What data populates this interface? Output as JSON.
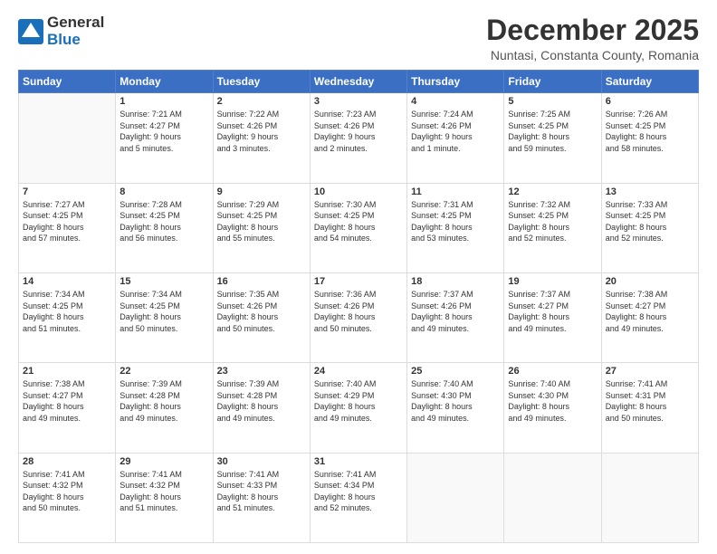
{
  "header": {
    "logo_general": "General",
    "logo_blue": "Blue",
    "month_title": "December 2025",
    "subtitle": "Nuntasi, Constanta County, Romania"
  },
  "weekdays": [
    "Sunday",
    "Monday",
    "Tuesday",
    "Wednesday",
    "Thursday",
    "Friday",
    "Saturday"
  ],
  "weeks": [
    [
      {
        "day": "",
        "info": ""
      },
      {
        "day": "1",
        "info": "Sunrise: 7:21 AM\nSunset: 4:27 PM\nDaylight: 9 hours\nand 5 minutes."
      },
      {
        "day": "2",
        "info": "Sunrise: 7:22 AM\nSunset: 4:26 PM\nDaylight: 9 hours\nand 3 minutes."
      },
      {
        "day": "3",
        "info": "Sunrise: 7:23 AM\nSunset: 4:26 PM\nDaylight: 9 hours\nand 2 minutes."
      },
      {
        "day": "4",
        "info": "Sunrise: 7:24 AM\nSunset: 4:26 PM\nDaylight: 9 hours\nand 1 minute."
      },
      {
        "day": "5",
        "info": "Sunrise: 7:25 AM\nSunset: 4:25 PM\nDaylight: 8 hours\nand 59 minutes."
      },
      {
        "day": "6",
        "info": "Sunrise: 7:26 AM\nSunset: 4:25 PM\nDaylight: 8 hours\nand 58 minutes."
      }
    ],
    [
      {
        "day": "7",
        "info": "Sunrise: 7:27 AM\nSunset: 4:25 PM\nDaylight: 8 hours\nand 57 minutes."
      },
      {
        "day": "8",
        "info": "Sunrise: 7:28 AM\nSunset: 4:25 PM\nDaylight: 8 hours\nand 56 minutes."
      },
      {
        "day": "9",
        "info": "Sunrise: 7:29 AM\nSunset: 4:25 PM\nDaylight: 8 hours\nand 55 minutes."
      },
      {
        "day": "10",
        "info": "Sunrise: 7:30 AM\nSunset: 4:25 PM\nDaylight: 8 hours\nand 54 minutes."
      },
      {
        "day": "11",
        "info": "Sunrise: 7:31 AM\nSunset: 4:25 PM\nDaylight: 8 hours\nand 53 minutes."
      },
      {
        "day": "12",
        "info": "Sunrise: 7:32 AM\nSunset: 4:25 PM\nDaylight: 8 hours\nand 52 minutes."
      },
      {
        "day": "13",
        "info": "Sunrise: 7:33 AM\nSunset: 4:25 PM\nDaylight: 8 hours\nand 52 minutes."
      }
    ],
    [
      {
        "day": "14",
        "info": "Sunrise: 7:34 AM\nSunset: 4:25 PM\nDaylight: 8 hours\nand 51 minutes."
      },
      {
        "day": "15",
        "info": "Sunrise: 7:34 AM\nSunset: 4:25 PM\nDaylight: 8 hours\nand 50 minutes."
      },
      {
        "day": "16",
        "info": "Sunrise: 7:35 AM\nSunset: 4:26 PM\nDaylight: 8 hours\nand 50 minutes."
      },
      {
        "day": "17",
        "info": "Sunrise: 7:36 AM\nSunset: 4:26 PM\nDaylight: 8 hours\nand 50 minutes."
      },
      {
        "day": "18",
        "info": "Sunrise: 7:37 AM\nSunset: 4:26 PM\nDaylight: 8 hours\nand 49 minutes."
      },
      {
        "day": "19",
        "info": "Sunrise: 7:37 AM\nSunset: 4:27 PM\nDaylight: 8 hours\nand 49 minutes."
      },
      {
        "day": "20",
        "info": "Sunrise: 7:38 AM\nSunset: 4:27 PM\nDaylight: 8 hours\nand 49 minutes."
      }
    ],
    [
      {
        "day": "21",
        "info": "Sunrise: 7:38 AM\nSunset: 4:27 PM\nDaylight: 8 hours\nand 49 minutes."
      },
      {
        "day": "22",
        "info": "Sunrise: 7:39 AM\nSunset: 4:28 PM\nDaylight: 8 hours\nand 49 minutes."
      },
      {
        "day": "23",
        "info": "Sunrise: 7:39 AM\nSunset: 4:28 PM\nDaylight: 8 hours\nand 49 minutes."
      },
      {
        "day": "24",
        "info": "Sunrise: 7:40 AM\nSunset: 4:29 PM\nDaylight: 8 hours\nand 49 minutes."
      },
      {
        "day": "25",
        "info": "Sunrise: 7:40 AM\nSunset: 4:30 PM\nDaylight: 8 hours\nand 49 minutes."
      },
      {
        "day": "26",
        "info": "Sunrise: 7:40 AM\nSunset: 4:30 PM\nDaylight: 8 hours\nand 49 minutes."
      },
      {
        "day": "27",
        "info": "Sunrise: 7:41 AM\nSunset: 4:31 PM\nDaylight: 8 hours\nand 50 minutes."
      }
    ],
    [
      {
        "day": "28",
        "info": "Sunrise: 7:41 AM\nSunset: 4:32 PM\nDaylight: 8 hours\nand 50 minutes."
      },
      {
        "day": "29",
        "info": "Sunrise: 7:41 AM\nSunset: 4:32 PM\nDaylight: 8 hours\nand 51 minutes."
      },
      {
        "day": "30",
        "info": "Sunrise: 7:41 AM\nSunset: 4:33 PM\nDaylight: 8 hours\nand 51 minutes."
      },
      {
        "day": "31",
        "info": "Sunrise: 7:41 AM\nSunset: 4:34 PM\nDaylight: 8 hours\nand 52 minutes."
      },
      {
        "day": "",
        "info": ""
      },
      {
        "day": "",
        "info": ""
      },
      {
        "day": "",
        "info": ""
      }
    ]
  ]
}
